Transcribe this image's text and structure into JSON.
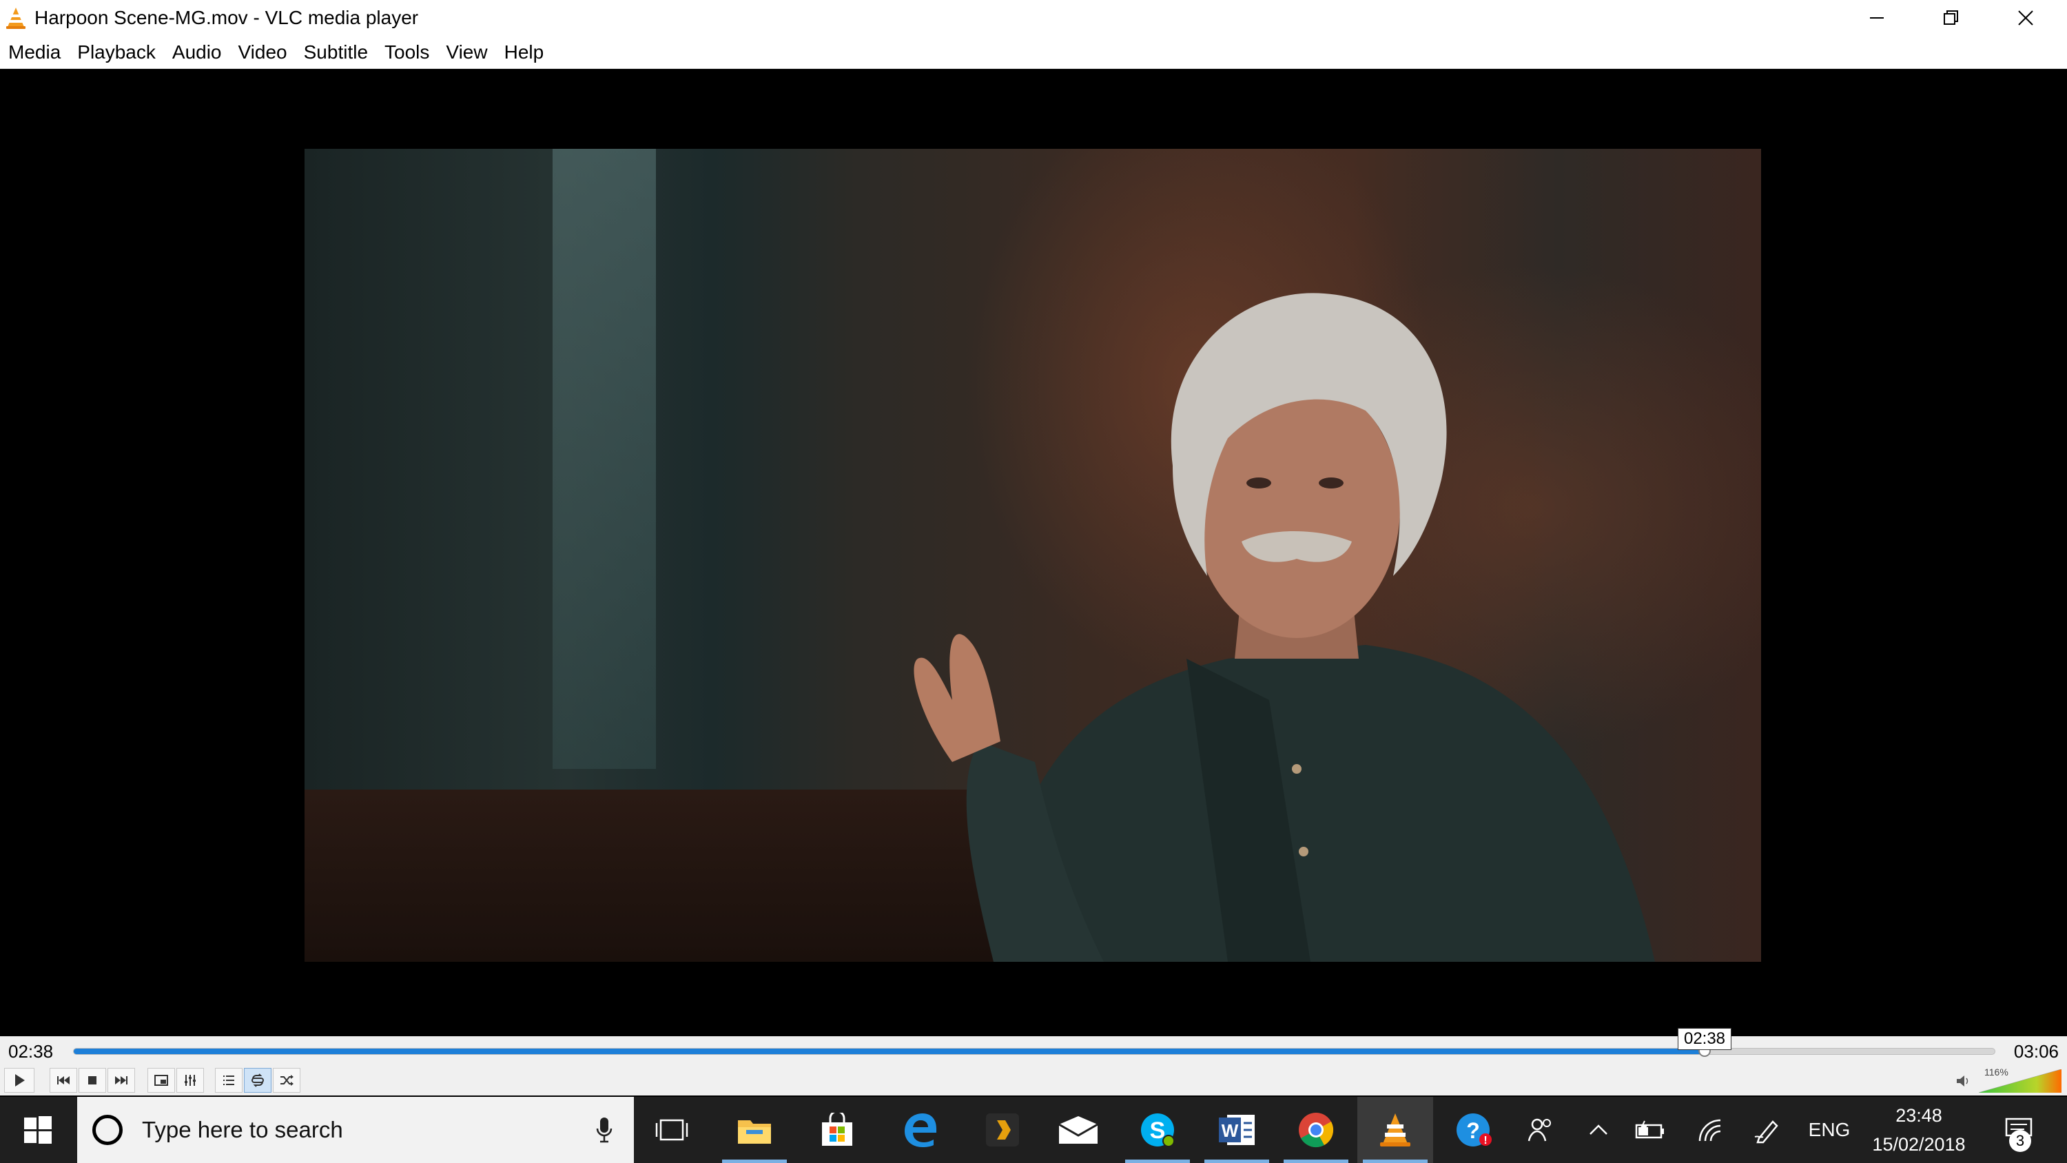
{
  "window": {
    "title": "Harpoon Scene-MG.mov - VLC media player",
    "icons": {
      "app": "vlc-cone-icon",
      "minimize": "minimize-icon",
      "restore": "restore-icon",
      "close": "close-icon"
    }
  },
  "menu": {
    "items": [
      "Media",
      "Playback",
      "Audio",
      "Video",
      "Subtitle",
      "Tools",
      "View",
      "Help"
    ]
  },
  "player": {
    "elapsed": "02:38",
    "total": "03:06",
    "seek_tooltip": "02:38",
    "progress_fraction": 0.849,
    "volume_label": "116%",
    "volume_fraction": 1.16,
    "colors": {
      "accent": "#1d7fd8",
      "volume_low": "#3cc43c",
      "volume_high": "#ff6a00"
    },
    "controls": [
      {
        "name": "play-button",
        "icon": "play-icon"
      },
      {
        "name": "previous-button",
        "icon": "skip-back-icon"
      },
      {
        "name": "stop-button",
        "icon": "stop-icon"
      },
      {
        "name": "next-button",
        "icon": "skip-forward-icon"
      },
      {
        "name": "fullscreen-button",
        "icon": "fullscreen-icon"
      },
      {
        "name": "extended-settings-button",
        "icon": "equalizer-icon"
      },
      {
        "name": "playlist-button",
        "icon": "playlist-icon"
      },
      {
        "name": "loop-button",
        "icon": "loop-icon"
      },
      {
        "name": "shuffle-button",
        "icon": "shuffle-icon"
      }
    ]
  },
  "taskbar": {
    "search_placeholder": "Type here to search",
    "apps": [
      "task-view-icon",
      "file-explorer-icon",
      "store-icon",
      "edge-icon",
      "plex-icon",
      "mail-icon",
      "skype-icon",
      "word-icon",
      "chrome-icon",
      "vlc-icon",
      "help-icon"
    ],
    "tray": {
      "language": "ENG",
      "time": "23:48",
      "date": "15/02/2018",
      "notification_count": "3"
    }
  }
}
